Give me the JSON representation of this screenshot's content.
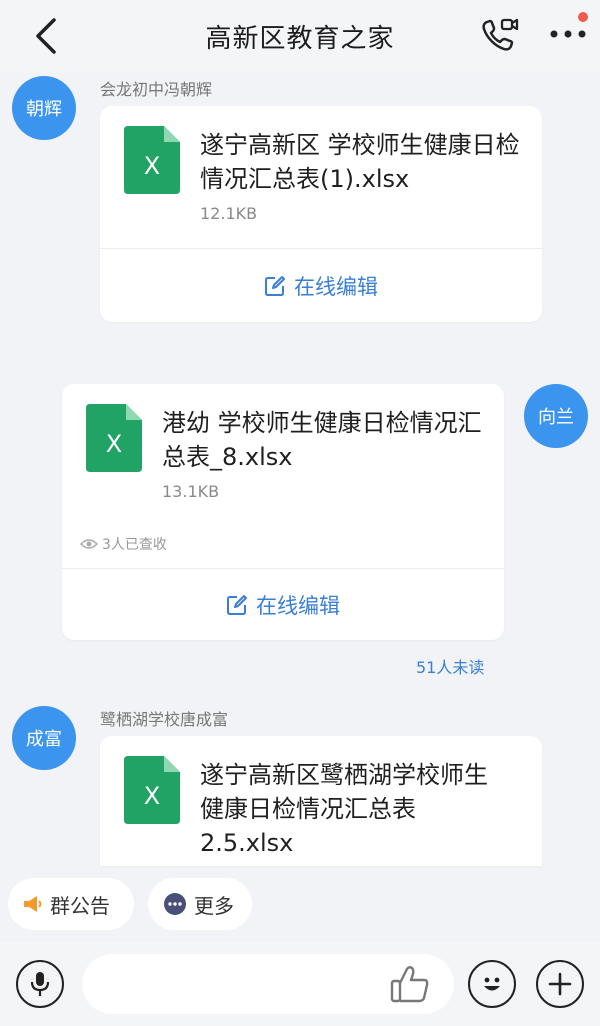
{
  "header": {
    "title": "高新区教育之家"
  },
  "messages": [
    {
      "avatar": "朝辉",
      "sender": "会龙初中冯朝辉",
      "file_name": "遂宁高新区  学校师生健康日检情况汇总表(1).xlsx",
      "file_size": "12.1KB",
      "edit_label": "在线编辑",
      "file_icon": "excel-icon"
    },
    {
      "avatar": "向兰",
      "file_name": "港幼  学校师生健康日检情况汇总表_8.xlsx",
      "file_size": "13.1KB",
      "read_note": "3人已查收",
      "edit_label": "在线编辑",
      "unread": "51人未读",
      "file_icon": "excel-icon"
    },
    {
      "avatar": "成富",
      "sender": "鹭栖湖学校唐成富",
      "file_name": "遂宁高新区鹭栖湖学校师生健康日检情况汇总表2.5.xlsx",
      "file_icon": "excel-icon"
    }
  ],
  "quick_actions": {
    "announcement": "群公告",
    "more": "更多"
  },
  "input": {
    "placeholder": ""
  },
  "colors": {
    "accent": "#3a7fd5",
    "avatar": "#3b95ee",
    "excel": "#21a366",
    "badge": "#f25a4a"
  }
}
